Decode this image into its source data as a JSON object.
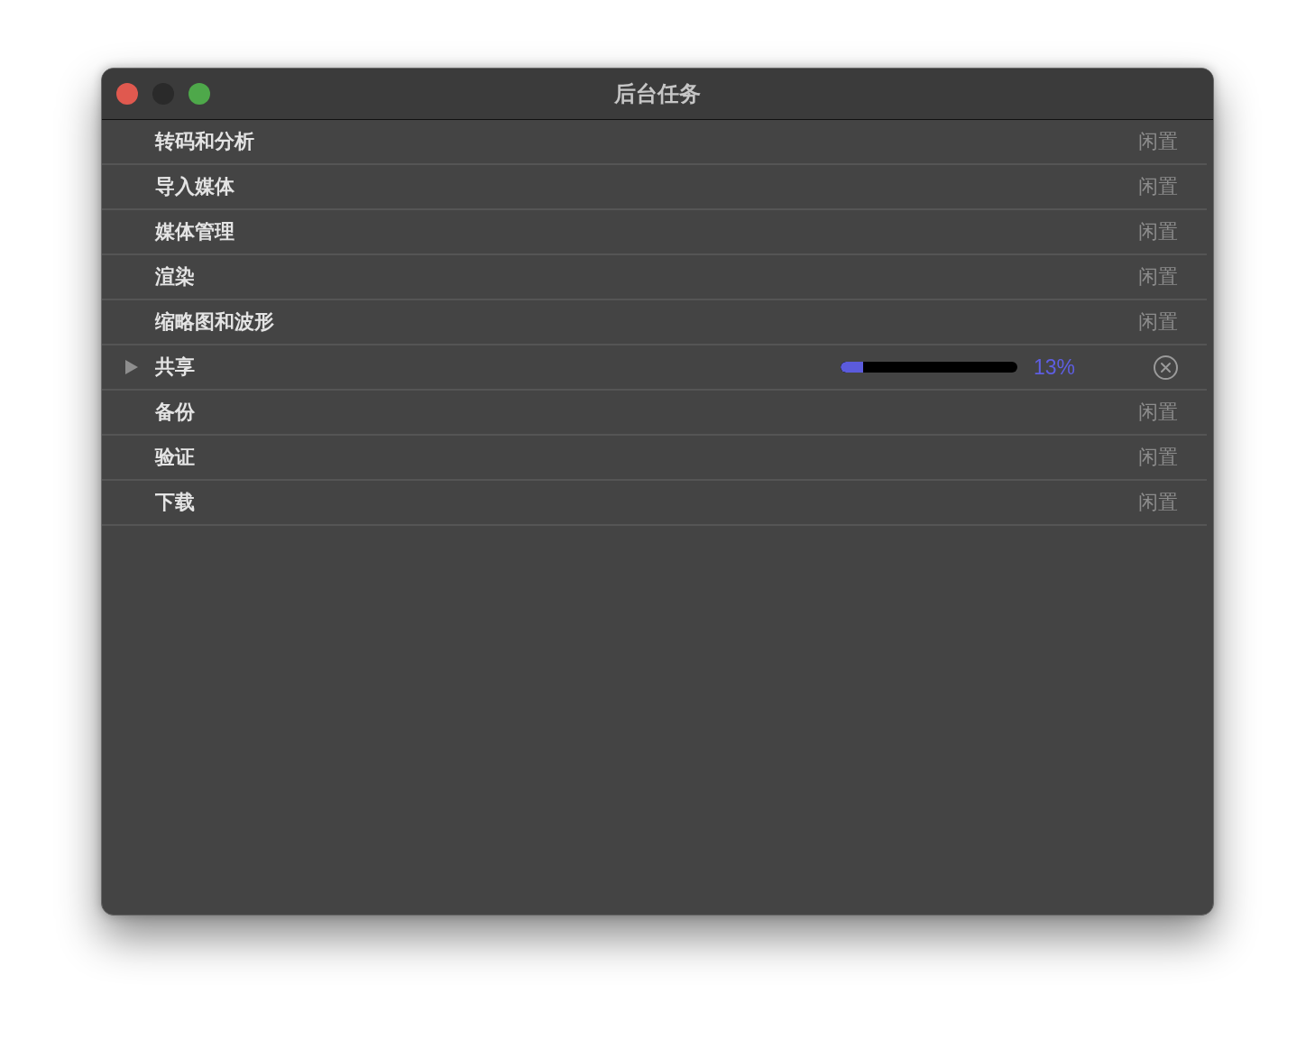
{
  "window": {
    "title": "后台任务",
    "controls": [
      {
        "kind": "close",
        "disabled": false
      },
      {
        "kind": "minimize",
        "disabled": true
      },
      {
        "kind": "zoom",
        "disabled": false
      }
    ]
  },
  "tasks": [
    {
      "name": "转码和分析",
      "kind": "idle",
      "status": "闲置"
    },
    {
      "name": "导入媒体",
      "kind": "idle",
      "status": "闲置"
    },
    {
      "name": "媒体管理",
      "kind": "idle",
      "status": "闲置"
    },
    {
      "name": "渲染",
      "kind": "idle",
      "status": "闲置"
    },
    {
      "name": "缩略图和波形",
      "kind": "idle",
      "status": "闲置"
    },
    {
      "name": "共享",
      "kind": "progress",
      "expanded": false,
      "level": 0.13,
      "reading": "13%"
    },
    {
      "name": "备份",
      "kind": "idle",
      "status": "闲置"
    },
    {
      "name": "验证",
      "kind": "idle",
      "status": "闲置"
    },
    {
      "name": "下载",
      "kind": "idle",
      "status": "闲置"
    }
  ]
}
